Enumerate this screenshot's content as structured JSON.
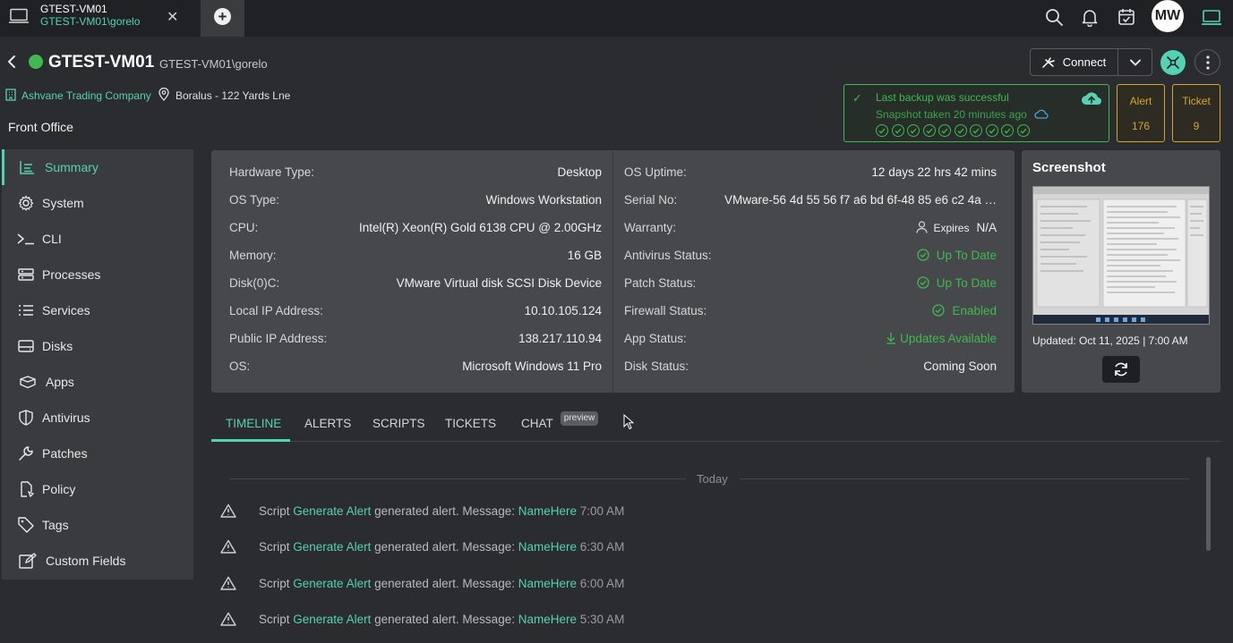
{
  "tab": {
    "title": "GTEST-VM01",
    "subtitle": "GTEST-VM01\\gorelo",
    "close": "✕"
  },
  "topbar": {
    "avatar_initials": "MW"
  },
  "header": {
    "device_name": "GTEST-VM01",
    "device_user": "GTEST-VM01\\gorelo",
    "status_color": "#3fb950",
    "connect_label": "Connect",
    "company": "Ashvane Trading Company",
    "location": "Boralus - 122 Yards Lne",
    "site": "Front Office"
  },
  "backup": {
    "title": "Last backup was successful",
    "subtitle": "Snapshot taken 20 minutes ago",
    "success_count": 10
  },
  "counters": {
    "alert_label": "Alert",
    "alert_count": "176",
    "ticket_label": "Ticket",
    "ticket_count": "9"
  },
  "sidebar": {
    "items": [
      {
        "label": "Summary",
        "icon": "summary-icon"
      },
      {
        "label": "System",
        "icon": "gear-icon"
      },
      {
        "label": "CLI",
        "icon": "terminal-icon"
      },
      {
        "label": "Processes",
        "icon": "processes-icon"
      },
      {
        "label": "Services",
        "icon": "services-icon"
      },
      {
        "label": "Disks",
        "icon": "disk-icon"
      },
      {
        "label": "Apps",
        "icon": "apps-icon"
      },
      {
        "label": "Antivirus",
        "icon": "shield-icon"
      },
      {
        "label": "Patches",
        "icon": "wrench-icon"
      },
      {
        "label": "Policy",
        "icon": "policy-icon"
      },
      {
        "label": "Tags",
        "icon": "tag-icon"
      },
      {
        "label": "Custom Fields",
        "icon": "edit-icon"
      }
    ]
  },
  "info_left": [
    {
      "key": "Hardware Type:",
      "value": "Desktop"
    },
    {
      "key": "OS Type:",
      "value": "Windows Workstation"
    },
    {
      "key": "CPU:",
      "value": "Intel(R) Xeon(R) Gold 6138 CPU @ 2.00GHz"
    },
    {
      "key": "Memory:",
      "value": "16 GB"
    },
    {
      "key": "Disk(0)C:",
      "value": "VMware Virtual disk SCSI Disk Device"
    },
    {
      "key": "Local IP Address:",
      "value": "10.10.105.124"
    },
    {
      "key": "Public IP Address:",
      "value": "138.217.110.94"
    },
    {
      "key": "OS:",
      "value": "Microsoft Windows 11 Pro"
    }
  ],
  "info_right": [
    {
      "key": "OS Uptime:",
      "value": "12 days 22 hrs 42 mins"
    },
    {
      "key": "Serial No:",
      "value": "VMware-56 4d 55 56 f7 a6 bd 6f-48 85 e6 c2 4a …"
    },
    {
      "key": "Warranty:",
      "value_prefix": "Expires",
      "value": "N/A"
    },
    {
      "key": "Antivirus Status:",
      "value": "Up To Date"
    },
    {
      "key": "Patch Status:",
      "value": "Up To Date"
    },
    {
      "key": "Firewall Status:",
      "value": "Enabled"
    },
    {
      "key": "App Status:",
      "value": "Updates Available"
    },
    {
      "key": "Disk Status:",
      "value": "Coming Soon"
    }
  ],
  "screenshot": {
    "title": "Screenshot",
    "updated": "Updated: Oct 11, 2025 | 7:00 AM"
  },
  "tabs": {
    "timeline": "TIMELINE",
    "alerts": "ALERTS",
    "scripts": "SCRIPTS",
    "tickets": "TICKETS",
    "chat": "CHAT",
    "chat_badge": "preview"
  },
  "timeline": {
    "group": "Today",
    "items": [
      {
        "prefix": "Script",
        "script": "Generate Alert",
        "middle": "generated alert. Message:",
        "message": "NameHere",
        "time": "7:00 AM"
      },
      {
        "prefix": "Script",
        "script": "Generate Alert",
        "middle": "generated alert. Message:",
        "message": "NameHere",
        "time": "6:30 AM"
      },
      {
        "prefix": "Script",
        "script": "Generate Alert",
        "middle": "generated alert. Message:",
        "message": "NameHere",
        "time": "6:00 AM"
      },
      {
        "prefix": "Script",
        "script": "Generate Alert",
        "middle": "generated alert. Message:",
        "message": "NameHere",
        "time": "5:30 AM"
      }
    ]
  },
  "colors": {
    "accent": "#55d1b4",
    "success": "#3fb950",
    "warning": "#d4a72c"
  }
}
